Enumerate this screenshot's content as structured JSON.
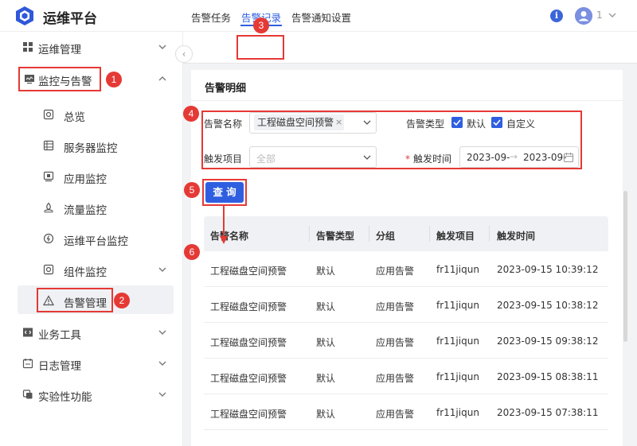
{
  "app": {
    "title": "运维平台",
    "user_count": "1"
  },
  "sidebar": {
    "items": [
      {
        "label": "运维管理"
      },
      {
        "label": "监控与告警"
      },
      {
        "label": "总览"
      },
      {
        "label": "服务器监控"
      },
      {
        "label": "应用监控"
      },
      {
        "label": "流量监控"
      },
      {
        "label": "运维平台监控"
      },
      {
        "label": "组件监控"
      },
      {
        "label": "告警管理"
      },
      {
        "label": "业务工具"
      },
      {
        "label": "日志管理"
      },
      {
        "label": "实验性功能"
      }
    ]
  },
  "tabs": [
    {
      "label": "告警任务"
    },
    {
      "label": "告警记录"
    },
    {
      "label": "告警通知设置"
    }
  ],
  "panel": {
    "title": "告警明细",
    "filters": {
      "alert_name_label": "告警名称",
      "alert_name_tag": "工程磁盘空间预警",
      "alert_type_label": "告警类型",
      "type_default": "默认",
      "type_custom": "自定义",
      "trigger_item_label": "触发项目",
      "trigger_item_placeholder": "全部",
      "trigger_time_label": "触发时间",
      "date_start": "2023-09-",
      "date_end": "2023-09-"
    },
    "query_button": "查 询"
  },
  "table": {
    "headers": [
      "告警名称",
      "告警类型",
      "分组",
      "触发项目",
      "触发时间"
    ],
    "rows": [
      [
        "工程磁盘空间预警",
        "默认",
        "应用告警",
        "fr11jiqun",
        "2023-09-15 10:39:12"
      ],
      [
        "工程磁盘空间预警",
        "默认",
        "应用告警",
        "fr11jiqun",
        "2023-09-15 10:38:12"
      ],
      [
        "工程磁盘空间预警",
        "默认",
        "应用告警",
        "fr11jiqun",
        "2023-09-15 09:38:12"
      ],
      [
        "工程磁盘空间预警",
        "默认",
        "应用告警",
        "fr11jiqun",
        "2023-09-15 08:38:11"
      ],
      [
        "工程磁盘空间预警",
        "默认",
        "应用告警",
        "fr11jiqun",
        "2023-09-15 07:38:11"
      ]
    ]
  },
  "annotations": [
    "1",
    "2",
    "3",
    "4",
    "5",
    "6"
  ],
  "colors": {
    "accent": "#2f5fe0",
    "annotation": "#e53935"
  }
}
